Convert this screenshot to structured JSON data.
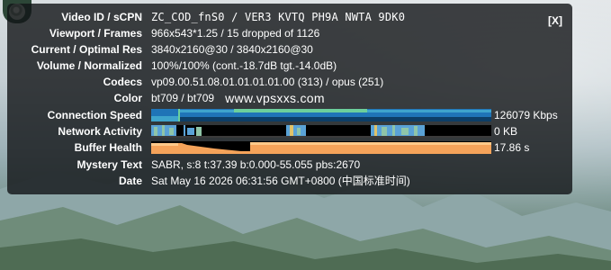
{
  "stats_panel": {
    "close_label": "[X]",
    "rows": [
      {
        "label": "Video ID / sCPN",
        "value": "ZC_COD_fnS0  /  VER3 KVTQ PH9A NWTA 9DK0"
      },
      {
        "label": "Viewport / Frames",
        "value": "966x543*1.25 / 15 dropped of 1126"
      },
      {
        "label": "Current / Optimal Res",
        "value": "3840x2160@30 / 3840x2160@30"
      },
      {
        "label": "Volume / Normalized",
        "value": "100%/100% (cont.-18.7dB tgt.-14.0dB)"
      },
      {
        "label": "Codecs",
        "value": "vp09.00.51.08.01.01.01.01.00 (313) / opus (251)"
      },
      {
        "label": "Color",
        "value": "bt709 / bt709",
        "watermark": "www.vpsxxs.com"
      }
    ],
    "graphs": [
      {
        "label": "Connection Speed",
        "value": "126079 Kbps"
      },
      {
        "label": "Network Activity",
        "value": "0 KB"
      },
      {
        "label": "Buffer Health",
        "value": "17.86 s"
      }
    ],
    "mystery": {
      "label": "Mystery Text",
      "value": "SABR, s:8 t:37.39 b:0.000-55.055 pbs:2670"
    },
    "date": {
      "label": "Date",
      "value": "Sat May 16 2026 06:31:56 GMT+0800 (中国标准时间)"
    }
  },
  "colors": {
    "panel_bg": "#141618",
    "speed_fill": "#1f74b7",
    "speed_band": "#3ea4cc",
    "speed_peak": "#6ccf9c",
    "network_fill": "#5aa2d6",
    "network_alt": "#8fc5a8",
    "buffer_fill": "#f5a35a",
    "buffer_band": "#ffc98a"
  },
  "icons": {
    "logo": "channel-logo-icon"
  }
}
